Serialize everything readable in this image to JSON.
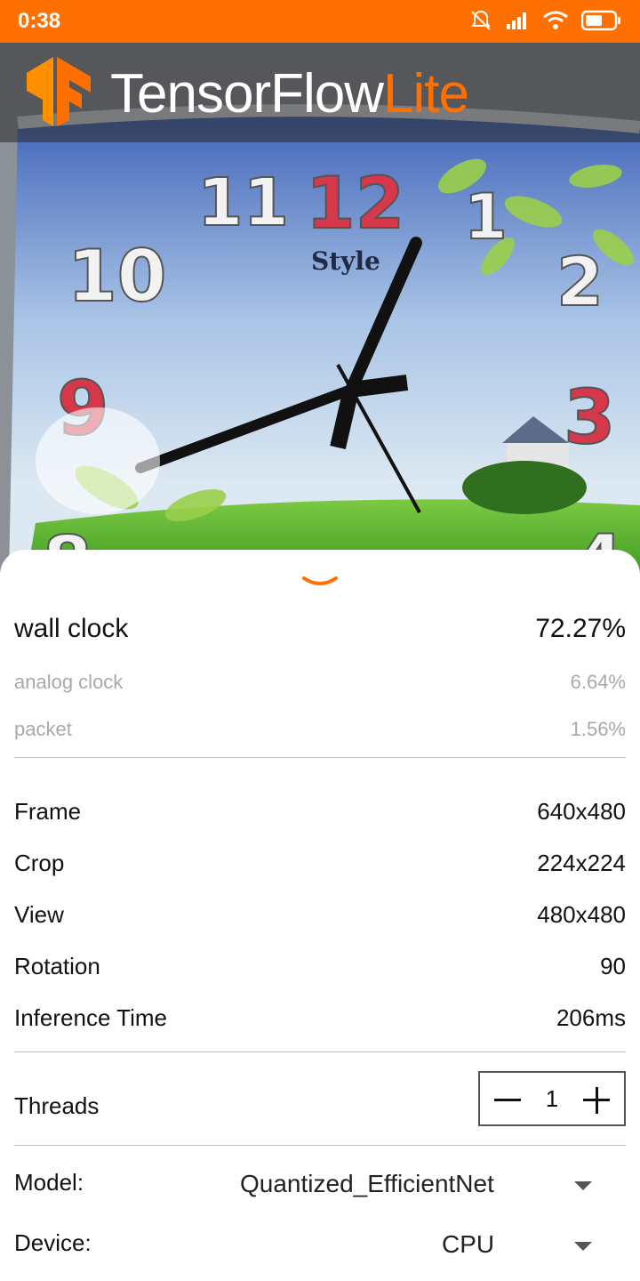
{
  "status_bar": {
    "time": "0:38"
  },
  "app_bar": {
    "brand_main": "TensorFlow",
    "brand_accent": "Lite"
  },
  "results": [
    {
      "label": "wall clock",
      "score": "72.27%"
    },
    {
      "label": "analog clock",
      "score": "6.64%"
    },
    {
      "label": "packet",
      "score": "1.56%"
    }
  ],
  "stats": [
    {
      "label": "Frame",
      "value": "640x480"
    },
    {
      "label": "Crop",
      "value": "224x224"
    },
    {
      "label": "View",
      "value": "480x480"
    },
    {
      "label": "Rotation",
      "value": "90"
    },
    {
      "label": "Inference Time",
      "value": "206ms"
    }
  ],
  "threads": {
    "label": "Threads",
    "value": "1"
  },
  "model": {
    "label": "Model:",
    "value": "Quantized_EfficientNet"
  },
  "device": {
    "label": "Device:",
    "value": "CPU"
  },
  "colors": {
    "accent": "#FF7000"
  }
}
